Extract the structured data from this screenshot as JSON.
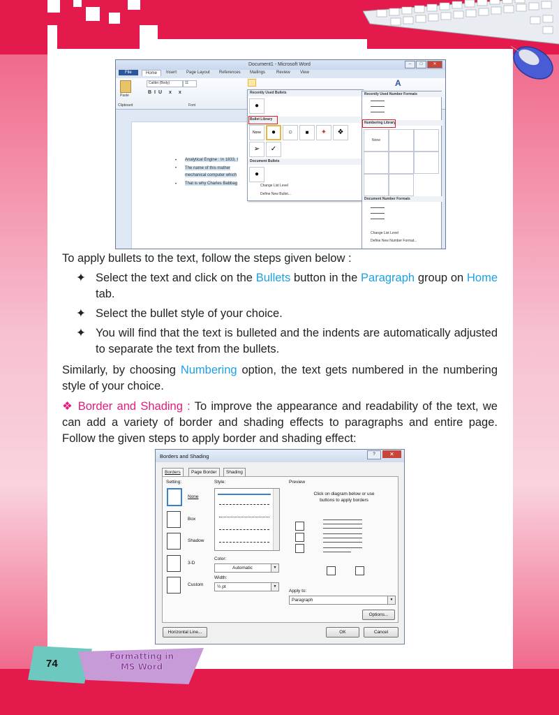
{
  "word_screenshot": {
    "title": "Document1 - Microsoft Word",
    "tabs": [
      "File",
      "Home",
      "Insert",
      "Page Layout",
      "References",
      "Mailings",
      "Review",
      "View"
    ],
    "font_name": "Calibri (Body)",
    "font_size": "11",
    "group_labels": {
      "clipboard": "Clipboard",
      "font": "Font",
      "paste": "Paste"
    },
    "bullets_dropdown": {
      "recently_used": "Recently Used Bullets",
      "library": "Bullet Library",
      "none": "None",
      "document_bullets": "Document Bullets",
      "change_list_level": "Change List Level",
      "define_new_bullet": "Define New Bullet..."
    },
    "numbering_dropdown": {
      "recently_used": "Recently Used Number Formats",
      "library": "Numbering Library",
      "none": "None",
      "document_formats": "Document Number Formats",
      "change_list_level": "Change List Level",
      "define_new_format": "Define New Number Format..."
    },
    "doc_lines": [
      "Analytical Engine : In 1833, I",
      "The name of this mather",
      "mechanical computer which",
      "That is why Charles Babbag"
    ]
  },
  "body": {
    "intro": "To apply bullets to the text, follow the steps given below :",
    "step1_a": "Select the text and click on the ",
    "step1_b": "Bullets",
    "step1_c": " button in the ",
    "step1_d": "Paragraph",
    "step1_e": " group on ",
    "step1_f": "Home",
    "step1_g": " tab.",
    "step2": "Select the bullet style of your choice.",
    "step3": "You will find that the text is bulleted and the indents are automatically adjusted to separate the text from the bullets.",
    "similar_a": "Similarly, by choosing ",
    "similar_b": "Numbering",
    "similar_c": " option, the text gets numbered in the numbering style of your choice.",
    "border_heading": "Border and Shading :",
    "border_text": " To improve the appearance and readability of the text, we can add a variety of border and shading effects to paragraphs and entire page. Follow the given steps to apply border and shading effect:"
  },
  "dialog": {
    "title": "Borders and Shading",
    "tabs": [
      "Borders",
      "Page Border",
      "Shading"
    ],
    "setting_label": "Setting:",
    "settings": [
      "None",
      "Box",
      "Shadow",
      "3-D",
      "Custom"
    ],
    "style_label": "Style:",
    "color_label": "Color:",
    "color_value": "Automatic",
    "width_label": "Width:",
    "width_value": "½ pt",
    "preview_label": "Preview",
    "preview_hint": "Click on diagram below or use buttons to apply borders",
    "apply_to_label": "Apply to:",
    "apply_to_value": "Paragraph",
    "options_btn": "Options...",
    "horizontal_line_btn": "Horizontal Line...",
    "ok_btn": "OK",
    "cancel_btn": "Cancel"
  },
  "footer": {
    "page_number": "74",
    "chapter_line1": "Formatting in",
    "chapter_line2": "MS Word"
  },
  "colors": {
    "brand_red": "#e51a4c",
    "highlight_blue": "#1ba1e2",
    "heading_pink": "#e51a7a"
  }
}
